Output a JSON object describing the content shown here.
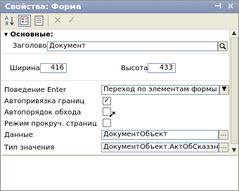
{
  "window": {
    "title": "Свойства: Форма"
  },
  "toolbar": {
    "sort_label": "А\nЯ",
    "delete_icon": "✕",
    "ok_icon": "✓"
  },
  "group": {
    "title": "Основные:"
  },
  "properties": {
    "title_label": "Заголовок",
    "title_value": "Документ",
    "width_label": "Ширина",
    "width_value": "416",
    "height_label": "Высота",
    "height_value": "433",
    "enter_label": "Поведение Enter",
    "enter_value": "Переход по элементам формы",
    "anchor_label": "Автопривязка границ",
    "anchor_checked": true,
    "order_label": "Автопорядок обхода",
    "order_checked": false,
    "scroll_label": "Режим прокруч. страниц",
    "scroll_checked": false,
    "data_label": "Данные",
    "data_value": "ДокументОбъект",
    "type_label": "Тип значения",
    "type_value": "ДокументОбъект.АктОбСказэнн"
  }
}
